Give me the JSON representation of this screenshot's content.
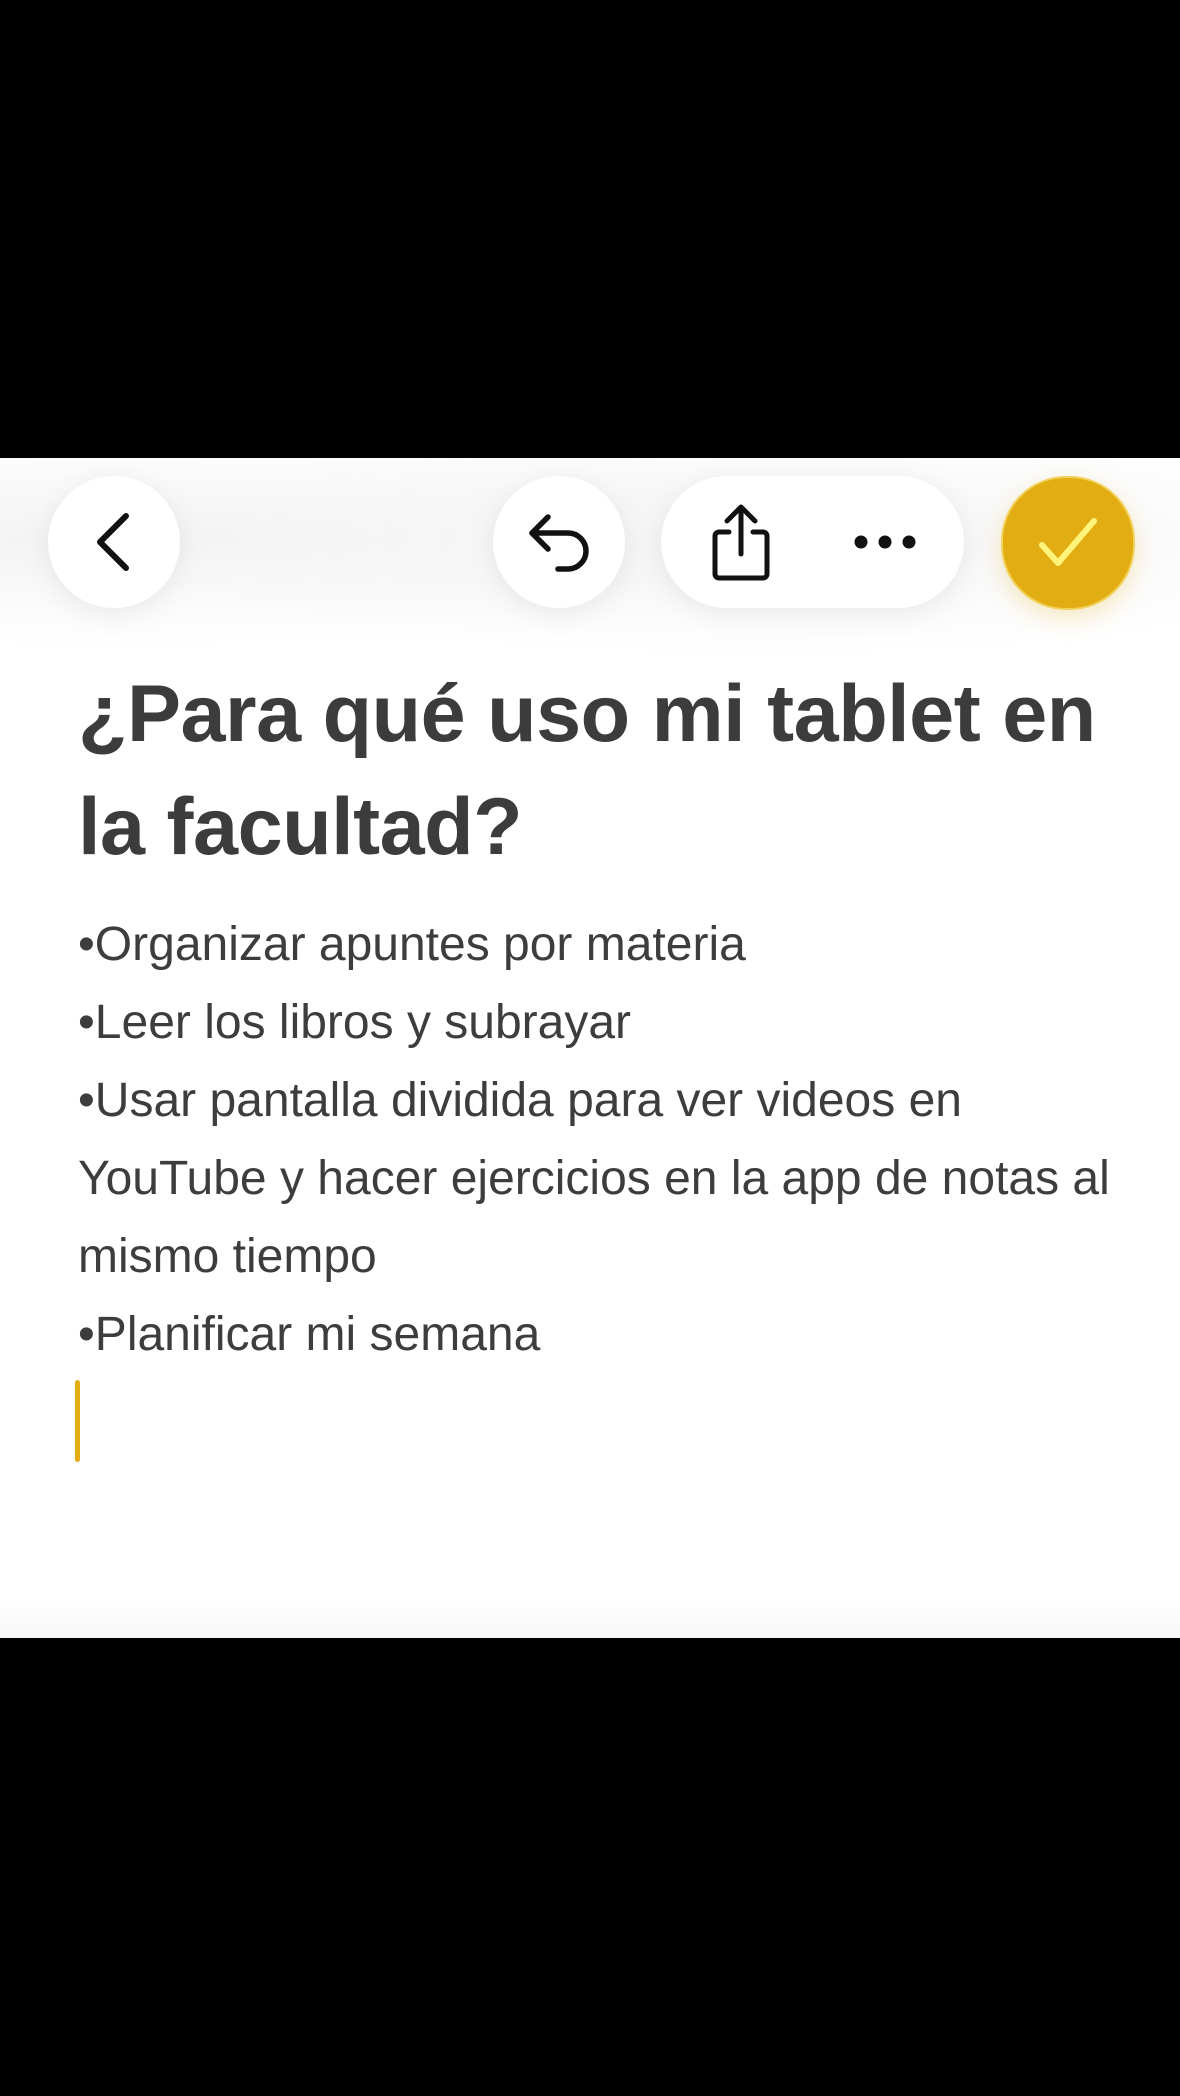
{
  "toolbar": {
    "back_icon": "chevron-left-icon",
    "undo_icon": "undo-arrow-icon",
    "share_icon": "share-icon",
    "more_icon": "ellipsis-icon",
    "done_icon": "checkmark-icon"
  },
  "note": {
    "title": "¿Para qué uso mi tablet en la facultad?",
    "body": [
      "•Organizar apuntes por materia",
      "•Leer los libros y subrayar",
      "•Usar pantalla dividida para ver videos en YouTube y hacer ejercicios en la app de notas al mismo tiempo",
      "•Planificar mi semana"
    ]
  },
  "colors": {
    "accent": "#e2ad12",
    "text": "#3c3c3c",
    "background": "#ffffff",
    "letterbox": "#000000"
  }
}
